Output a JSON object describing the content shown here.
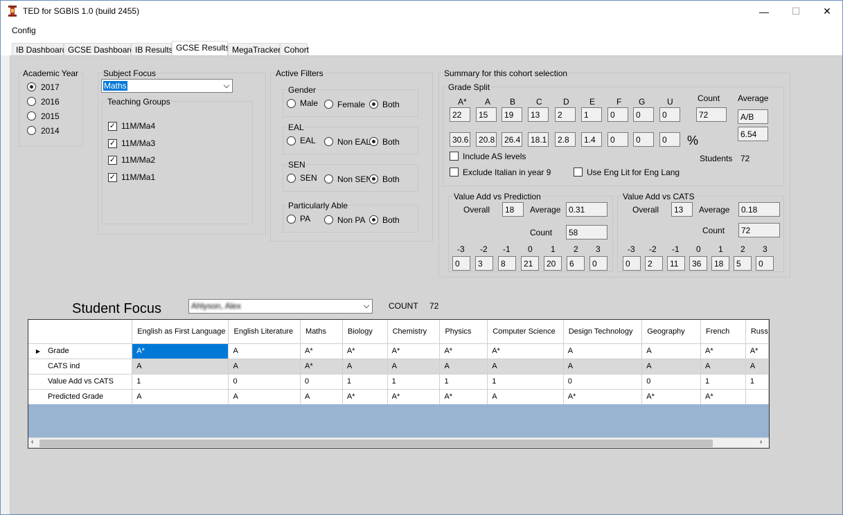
{
  "window": {
    "title": "TED for SGBIS 1.0 (build 2455)",
    "minimize": "—",
    "maximize": "☐",
    "close": "✕"
  },
  "menu": {
    "config": "Config"
  },
  "tabs": [
    "IB Dashboard",
    "GCSE Dashboard",
    "IB Results",
    "GCSE Results",
    "MegaTracker",
    "Cohort"
  ],
  "active_tab": "GCSE Results",
  "academic_year": {
    "title": "Academic Year",
    "options": [
      "2017",
      "2016",
      "2015",
      "2014"
    ],
    "selected": "2017"
  },
  "subject_focus": {
    "title": "Subject Focus",
    "selected": "Maths",
    "teaching_groups_title": "Teaching Groups",
    "groups": [
      "11M/Ma4",
      "11M/Ma3",
      "11M/Ma2",
      "11M/Ma1"
    ]
  },
  "active_filters": {
    "title": "Active Filters",
    "gender": {
      "title": "Gender",
      "options": [
        "Male",
        "Female",
        "Both"
      ],
      "selected": "Both"
    },
    "eal": {
      "title": "EAL",
      "options": [
        "EAL",
        "Non EAL",
        "Both"
      ],
      "selected": "Both"
    },
    "sen": {
      "title": "SEN",
      "options": [
        "SEN",
        "Non SEN",
        "Both"
      ],
      "selected": "Both"
    },
    "pa": {
      "title": "Particularly Able",
      "options": [
        "PA",
        "Non PA",
        "Both"
      ],
      "selected": "Both"
    }
  },
  "summary": {
    "title": "Summary for this cohort selection",
    "grade_split_title": "Grade Split",
    "grades": [
      "A*",
      "A",
      "B",
      "C",
      "D",
      "E",
      "F",
      "G",
      "U"
    ],
    "counts": [
      "22",
      "15",
      "19",
      "13",
      "2",
      "1",
      "0",
      "0",
      "0"
    ],
    "percents": [
      "30.6",
      "20.8",
      "26.4",
      "18.1",
      "2.8",
      "1.4",
      "0",
      "0",
      "0"
    ],
    "percent_sign": "%",
    "count_label": "Count",
    "count_value": "72",
    "average_label": "Average",
    "average_grade": "A/B",
    "average_points": "6.54",
    "include_as": "Include AS levels",
    "exclude_italian": "Exclude Italian in year 9",
    "use_eng_lit": "Use Eng Lit for Eng Lang",
    "students_label": "Students",
    "students_value": "72"
  },
  "va_prediction": {
    "title": "Value Add vs Prediction",
    "overall_label": "Overall",
    "overall": "18",
    "average_label": "Average",
    "average": "0.31",
    "count_label": "Count",
    "count": "58",
    "bins": [
      "-3",
      "-2",
      "-1",
      "0",
      "1",
      "2",
      "3"
    ],
    "values": [
      "0",
      "3",
      "8",
      "21",
      "20",
      "6",
      "0"
    ]
  },
  "va_cats": {
    "title": "Value Add vs CATS",
    "overall_label": "Overall",
    "overall": "13",
    "average_label": "Average",
    "average": "0.18",
    "count_label": "Count",
    "count": "72",
    "bins": [
      "-3",
      "-2",
      "-1",
      "0",
      "1",
      "2",
      "3"
    ],
    "values": [
      "0",
      "2",
      "11",
      "36",
      "18",
      "5",
      "0"
    ]
  },
  "student_focus": {
    "title": "Student Focus",
    "selected_student": "Ahlyson, Alex",
    "count_label": "COUNT",
    "count": "72"
  },
  "grid": {
    "columns": [
      "English as First Language",
      "English Literature",
      "Maths",
      "Biology",
      "Chemistry",
      "Physics",
      "Computer Science",
      "Design Technology",
      "Geography",
      "French",
      "Russ"
    ],
    "rows": [
      {
        "label": "Grade",
        "cells": [
          "A*",
          "A",
          "A*",
          "A*",
          "A*",
          "A*",
          "A*",
          "A",
          "A",
          "A*",
          "A*"
        ]
      },
      {
        "label": "CATS ind",
        "cells": [
          "A",
          "A",
          "A*",
          "A",
          "A",
          "A",
          "A",
          "A",
          "A",
          "A",
          "A"
        ]
      },
      {
        "label": "Value Add vs CATS",
        "cells": [
          "1",
          "0",
          "0",
          "1",
          "1",
          "1",
          "1",
          "0",
          "0",
          "1",
          "1"
        ]
      },
      {
        "label": "Predicted Grade",
        "cells": [
          "A",
          "A",
          "A",
          "A*",
          "A*",
          "A*",
          "A",
          "A*",
          "A*",
          "A*",
          ""
        ]
      }
    ]
  },
  "colors": {
    "tab_page_bg": "#d4d4d4",
    "selected_cell": "#0078d7",
    "grid_empty": "#99b4d1"
  }
}
